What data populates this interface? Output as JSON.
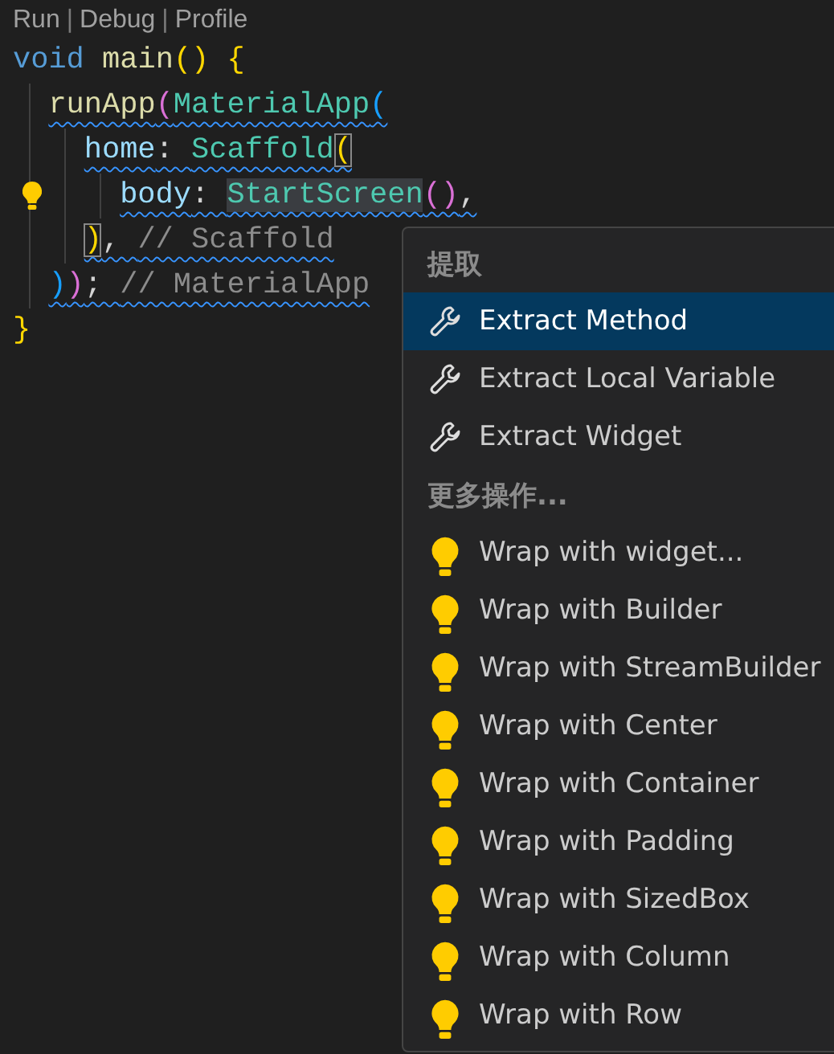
{
  "codelens": [
    {
      "kind": "link",
      "label": "Run"
    },
    {
      "kind": "separator",
      "label": "|"
    },
    {
      "kind": "link",
      "label": "Debug"
    },
    {
      "kind": "separator",
      "label": "|"
    },
    {
      "kind": "link",
      "label": "Profile"
    }
  ],
  "code_lines": [
    {
      "lightbulb": false,
      "warning": false,
      "tokens": [
        {
          "kind": "keyword",
          "text": "void "
        },
        {
          "kind": "function",
          "text": "main"
        },
        {
          "kind": "bracket1",
          "text": "() {"
        }
      ]
    },
    {
      "lightbulb": false,
      "warning": true,
      "guides": [
        {
          "kind": "guide"
        }
      ],
      "tokens": [
        {
          "kind": "function",
          "text": "runApp"
        },
        {
          "kind": "bracket2",
          "text": "("
        },
        {
          "kind": "class",
          "text": "MaterialApp"
        },
        {
          "kind": "bracket3",
          "text": "("
        }
      ]
    },
    {
      "lightbulb": false,
      "warning": true,
      "guides": [
        {
          "kind": "guide"
        },
        {
          "kind": "guide"
        }
      ],
      "tokens": [
        {
          "kind": "property",
          "text": "home"
        },
        {
          "kind": "punct",
          "text": ": "
        },
        {
          "kind": "class",
          "text": "Scaffold"
        },
        {
          "kind": "bracket1",
          "text": "(",
          "matched": true
        }
      ]
    },
    {
      "lightbulb": true,
      "warning": true,
      "guides": [
        {
          "kind": "guide"
        },
        {
          "kind": "guide"
        },
        {
          "kind": "guide"
        }
      ],
      "tokens": [
        {
          "kind": "property",
          "text": "body"
        },
        {
          "kind": "punct",
          "text": ": "
        },
        {
          "kind": "class",
          "text": "StartScreen",
          "highlighted": true
        },
        {
          "kind": "bracket2",
          "text": "()"
        },
        {
          "kind": "punct",
          "text": ","
        }
      ]
    },
    {
      "lightbulb": false,
      "warning": true,
      "guides": [
        {
          "kind": "guide"
        },
        {
          "kind": "guide"
        }
      ],
      "tokens": [
        {
          "kind": "bracket1",
          "text": ")",
          "matched": true
        },
        {
          "kind": "punct",
          "text": ", "
        },
        {
          "kind": "comment",
          "text": "// Scaffold"
        }
      ]
    },
    {
      "lightbulb": false,
      "warning": true,
      "guides": [
        {
          "kind": "guide"
        }
      ],
      "tokens": [
        {
          "kind": "bracket3",
          "text": ")"
        },
        {
          "kind": "bracket2",
          "text": ")"
        },
        {
          "kind": "punct",
          "text": "; "
        },
        {
          "kind": "comment",
          "text": "// MaterialApp"
        }
      ]
    },
    {
      "lightbulb": false,
      "warning": false,
      "tokens": [
        {
          "kind": "bracket1",
          "text": "}"
        }
      ]
    }
  ],
  "menu": {
    "items": [
      {
        "kind": "header",
        "label": "提取"
      },
      {
        "kind": "wrench",
        "label": "Extract Method",
        "selected": true
      },
      {
        "kind": "wrench",
        "label": "Extract Local Variable",
        "selected": false
      },
      {
        "kind": "wrench",
        "label": "Extract Widget",
        "selected": false
      },
      {
        "kind": "header",
        "label": "更多操作..."
      },
      {
        "kind": "bulb",
        "label": "Wrap with widget...",
        "selected": false
      },
      {
        "kind": "bulb",
        "label": "Wrap with Builder",
        "selected": false
      },
      {
        "kind": "bulb",
        "label": "Wrap with StreamBuilder",
        "selected": false
      },
      {
        "kind": "bulb",
        "label": "Wrap with Center",
        "selected": false
      },
      {
        "kind": "bulb",
        "label": "Wrap with Container",
        "selected": false
      },
      {
        "kind": "bulb",
        "label": "Wrap with Padding",
        "selected": false
      },
      {
        "kind": "bulb",
        "label": "Wrap with SizedBox",
        "selected": false
      },
      {
        "kind": "bulb",
        "label": "Wrap with Column",
        "selected": false
      },
      {
        "kind": "bulb",
        "label": "Wrap with Row",
        "selected": false
      }
    ]
  }
}
